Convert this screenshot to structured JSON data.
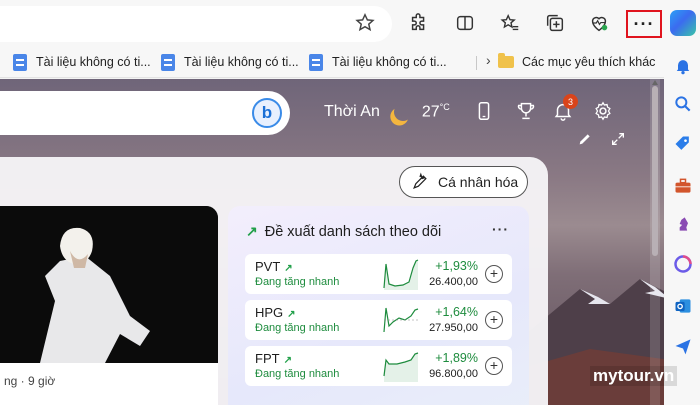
{
  "toolbar": {
    "icons": [
      "star-icon",
      "extensions-icon",
      "split-screen-icon",
      "favorites-icon",
      "collections-icon",
      "browser-essentials-icon"
    ],
    "more_label": "···"
  },
  "favorites_bar": {
    "items": [
      {
        "label": "Tài liệu không có ti...",
        "icon": "doc-icon"
      },
      {
        "label": "Tài liệu không có ti...",
        "icon": "doc-icon"
      },
      {
        "label": "Tài liệu không có ti...",
        "icon": "doc-icon"
      }
    ],
    "overflow": "›",
    "other_favorites": "Các mục yêu thích khác"
  },
  "sidebar": {
    "icons": [
      "notification-icon",
      "search-icon",
      "shopping-icon",
      "tools-icon",
      "games-icon",
      "microsoft365-icon",
      "outlook-icon",
      "drop-icon"
    ]
  },
  "newtab": {
    "weather": {
      "location": "Thời An",
      "temp": "27",
      "unit": "°C"
    },
    "notifications_count": "3",
    "personalize_label": "Cá nhân hóa",
    "news_meta": "ng · 9 giờ",
    "watchlist": {
      "title": "Đề xuất danh sách theo dõi",
      "more_label": "···",
      "stocks": [
        {
          "symbol": "PVT",
          "status": "Đang tăng nhanh",
          "change": "+1,93%",
          "price": "26.400,00",
          "add": "+"
        },
        {
          "symbol": "HPG",
          "status": "Đang tăng nhanh",
          "change": "+1,64%",
          "price": "27.950,00",
          "add": "+"
        },
        {
          "symbol": "FPT",
          "status": "Đang tăng nhanh",
          "change": "+1,89%",
          "price": "96.800,00",
          "add": "+"
        }
      ]
    }
  },
  "watermark": "mytour.vn",
  "colors": {
    "accent_red": "#e0141e",
    "positive_green": "#1e8c3e",
    "badge": "#d9441a"
  }
}
